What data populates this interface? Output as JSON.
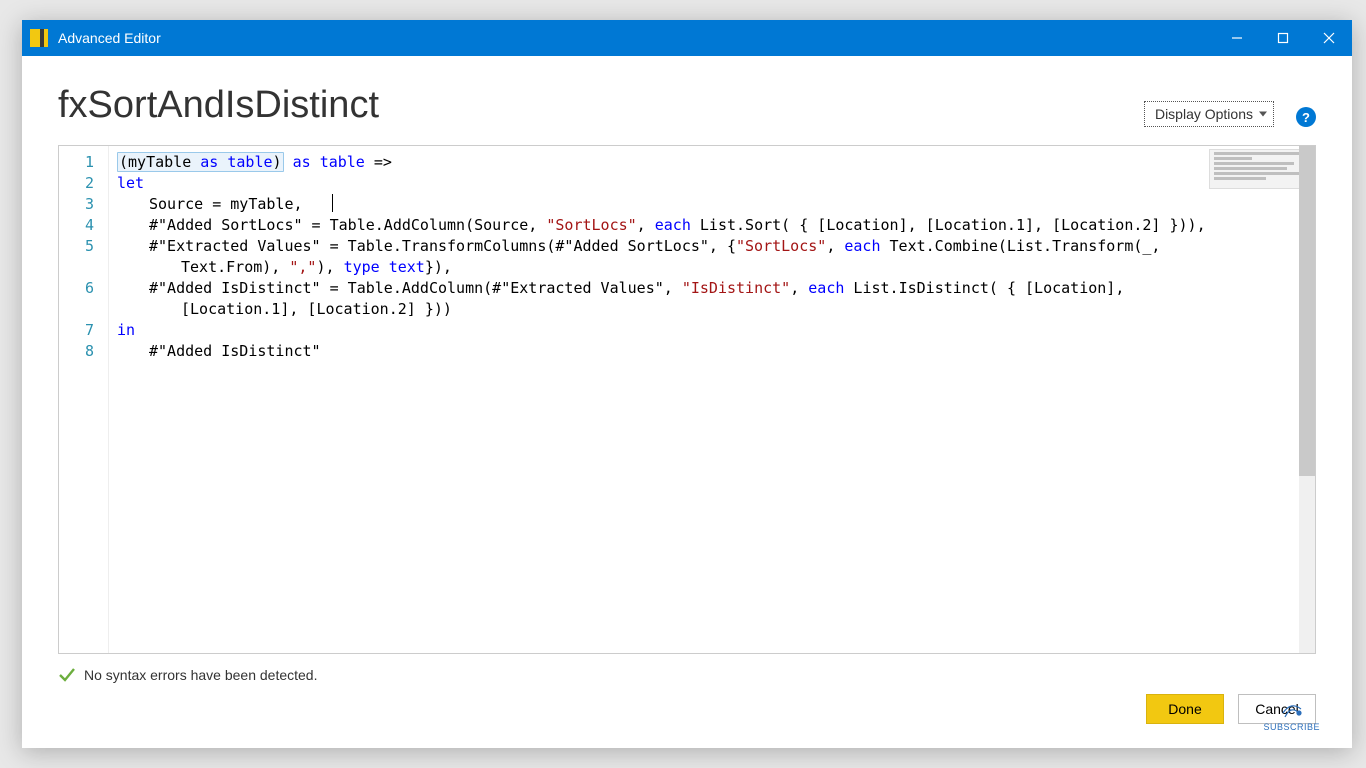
{
  "window": {
    "title": "Advanced Editor",
    "minimize": "Minimize",
    "maximize": "Maximize",
    "close": "Close"
  },
  "header": {
    "query_name": "fxSortAndIsDistinct",
    "display_options_label": "Display Options",
    "help": "?"
  },
  "editor": {
    "line_numbers": [
      "1",
      "2",
      "3",
      "4",
      "5",
      "6",
      "7",
      "8"
    ],
    "code": {
      "l1_a": "(myTable ",
      "l1_kw_as1": "as",
      "l1_b": " ",
      "l1_kw_table1": "table",
      "l1_c": ")",
      "l1_d": " ",
      "l1_kw_as2": "as",
      "l1_e": " ",
      "l1_kw_table2": "table",
      "l1_f": " =>",
      "l2_kw_let": "let",
      "l3": "Source = myTable,",
      "l4_a": "#\"Added SortLocs\" = Table.AddColumn(Source, ",
      "l4_str": "\"SortLocs\"",
      "l4_b": ", ",
      "l4_kw_each": "each",
      "l4_c": " List.Sort( { [Location], [Location.1], [Location.2] })),",
      "l5_a": "#\"Extracted Values\" = Table.TransformColumns(#\"Added SortLocs\", {",
      "l5_str": "\"SortLocs\"",
      "l5_b": ", ",
      "l5_kw_each": "each",
      "l5_c": " Text.Combine(List.Transform(_,",
      "l5w_a": "Text.From), ",
      "l5w_str": "\",\"",
      "l5w_b": "), ",
      "l5w_kw_type": "type",
      "l5w_c": " ",
      "l5w_kw_text": "text",
      "l5w_d": "}),",
      "l6_a": "#\"Added IsDistinct\" = Table.AddColumn(#\"Extracted Values\", ",
      "l6_str": "\"IsDistinct\"",
      "l6_b": ", ",
      "l6_kw_each": "each",
      "l6_c": " List.IsDistinct( { [Location],",
      "l6w": "[Location.1], [Location.2] }))",
      "l7_kw_in": "in",
      "l8": "#\"Added IsDistinct\""
    }
  },
  "status": {
    "message": "No syntax errors have been detected."
  },
  "buttons": {
    "done": "Done",
    "cancel": "Cancel"
  },
  "watermark": {
    "label": "SUBSCRIBE"
  }
}
